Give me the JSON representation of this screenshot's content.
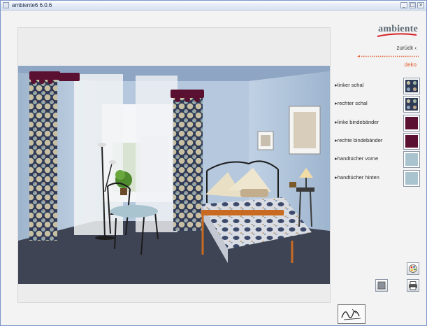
{
  "window": {
    "title": "ambiente6 6.0.6",
    "min_glyph": "_",
    "max_glyph": "□",
    "close_glyph": "×"
  },
  "sidebar": {
    "logo_text": "ambiente",
    "back_label": "zurück ‹",
    "section_label": "deko",
    "options": [
      {
        "label": "▸linker schal",
        "swatch": "pattern-blue"
      },
      {
        "label": "▸rechter schal",
        "swatch": "pattern-blue"
      },
      {
        "label": "▸linke bindebänder",
        "swatch": "#5a1030"
      },
      {
        "label": "▸rechte bindebänder",
        "swatch": "#5a1030"
      },
      {
        "label": "▸handtücher vorne",
        "swatch": "#a9c3cf"
      },
      {
        "label": "▸handtücher hinten",
        "swatch": "#a9c3cf"
      }
    ]
  },
  "colors": {
    "accent_dots": "#e05a2a",
    "logo_swoosh": "#d6252a",
    "wall": "#b7c9dd",
    "floor": "#3f4454",
    "ceiling": "#8ea5c3"
  },
  "icons": {
    "palette": "palette-icon",
    "print": "print-icon",
    "square": "square-icon",
    "signature": "signature-icon"
  }
}
